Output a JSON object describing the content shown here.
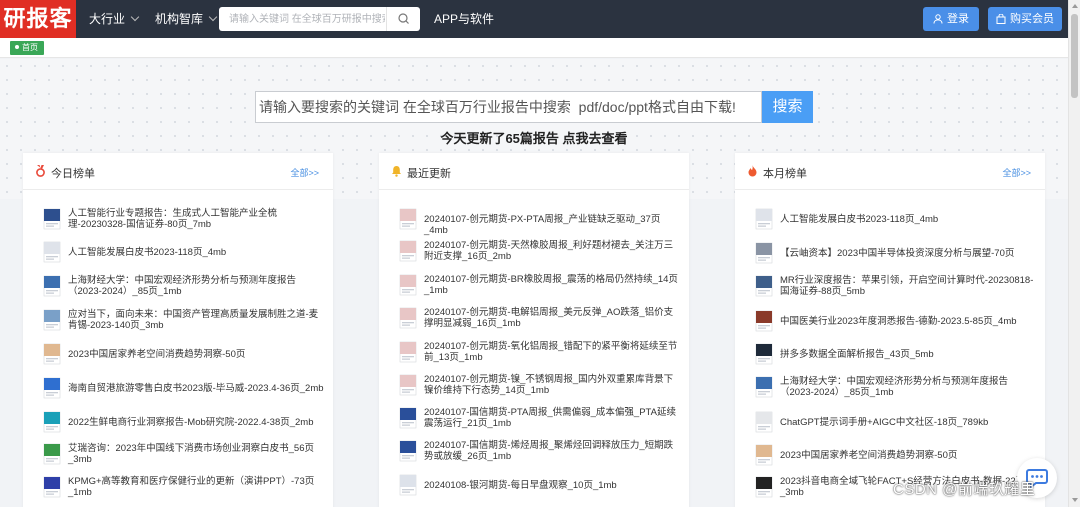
{
  "nav": {
    "logo": "研报客",
    "industry": "大行业",
    "institutions": "机构智库",
    "search_placeholder": "请输入关键词 在全球百万研报中搜索",
    "app": "APP与软件",
    "login": "登录",
    "buy_member": "购买会员"
  },
  "breadcrumb": {
    "home": "首页"
  },
  "hero": {
    "search_placeholder": "请输入要搜索的关键词 在全球百万行业报告中搜索  pdf/doc/ppt格式自由下载!",
    "search_button": "搜索",
    "update_text": "今天更新了65篇报告 点我去查看"
  },
  "colors": {
    "nav_bg": "#2b3340",
    "logo_bg": "#e02e24",
    "accent": "#4a8fe8",
    "home_badge": "#3aa757"
  },
  "cards": [
    {
      "title": "今日榜单",
      "icon": "medal-icon",
      "more": "全部>>",
      "items": [
        {
          "text": "人工智能行业专题报告：生成式人工智能产业全梳理-20230328-国信证券-80页_7mb",
          "thumb": "report-cover-icon",
          "color": "#2d4f8e"
        },
        {
          "text": "人工智能发展白皮书2023-118页_4mb",
          "thumb": "report-cover-icon",
          "color": "#dfe3ea"
        },
        {
          "text": "上海财经大学：中国宏观经济形势分析与预测年度报告（2023-2024）_85页_1mb",
          "thumb": "report-cover-icon",
          "color": "#3c6fb0"
        },
        {
          "text": "应对当下，面向未来：中国资产管理高质量发展制胜之道-麦肯锡-2023-140页_3mb",
          "thumb": "report-cover-icon",
          "color": "#7aa0c8"
        },
        {
          "text": "2023中国居家养老空间消费趋势洞察-50页",
          "thumb": "report-cover-icon",
          "color": "#e0b890"
        },
        {
          "text": "海南自贸港旅游零售白皮书2023版-毕马威-2023.4-36页_2mb",
          "thumb": "report-cover-icon",
          "color": "#2f6fd0"
        },
        {
          "text": "2022生鲜电商行业洞察报告-Mob研究院-2022.4-38页_2mb",
          "thumb": "report-cover-icon",
          "color": "#1aa0b8"
        },
        {
          "text": "艾瑞咨询：2023年中国线下消费市场创业洞察白皮书_56页_3mb",
          "thumb": "report-cover-icon",
          "color": "#3a9a4a"
        },
        {
          "text": "KPMG+高等教育和医疗保健行业的更新（演讲PPT）-73页_1mb",
          "thumb": "report-cover-icon",
          "color": "#2e3fa8"
        }
      ]
    },
    {
      "title": "最近更新",
      "icon": "bell-icon",
      "more": "",
      "items": [
        {
          "text": "20240107-创元期货-PX-PTA周报_产业链缺乏驱动_37页_4mb",
          "thumb": "report-cover-icon",
          "color": "#e8c6c6"
        },
        {
          "text": "20240107-创元期货-天然橡胶周报_利好题材褪去_关注万三附近支撑_16页_2mb",
          "thumb": "report-cover-icon",
          "color": "#e8c6c6"
        },
        {
          "text": "20240107-创元期货-BR橡胶周报_震荡的格局仍然持续_14页_1mb",
          "thumb": "report-cover-icon",
          "color": "#e8c6c6"
        },
        {
          "text": "20240107-创元期货-电解铝周报_美元反弹_AO跌落_铝价支撑明显减弱_16页_1mb",
          "thumb": "report-cover-icon",
          "color": "#e8c6c6"
        },
        {
          "text": "20240107-创元期货-氧化铝周报_错配下的紧平衡将延续至节前_13页_1mb",
          "thumb": "report-cover-icon",
          "color": "#e8c6c6"
        },
        {
          "text": "20240107-创元期货-镍_不锈钢周报_国内外双重累库背景下镍价维持下行态势_14页_1mb",
          "thumb": "report-cover-icon",
          "color": "#e8c6c6"
        },
        {
          "text": "20240107-国信期货-PTA周报_供需偏弱_成本偏强_PTA延续震荡运行_21页_1mb",
          "thumb": "report-cover-icon",
          "color": "#2a4f9a"
        },
        {
          "text": "20240107-国信期货-烯烃周报_聚烯烃回调释放压力_短期跌势或放缓_26页_1mb",
          "thumb": "report-cover-icon",
          "color": "#2a4f9a"
        },
        {
          "text": "20240108-银河期货-每日早盘观察_10页_1mb",
          "thumb": "report-cover-icon",
          "color": "#dde2ea"
        }
      ]
    },
    {
      "title": "本月榜单",
      "icon": "fire-icon",
      "more": "全部>>",
      "items": [
        {
          "text": "人工智能发展白皮书2023-118页_4mb",
          "thumb": "report-cover-icon",
          "color": "#dfe3ea"
        },
        {
          "text": "【云岫资本】2023中国半导体投资深度分析与展望-70页",
          "thumb": "report-cover-icon",
          "color": "#8a94a4"
        },
        {
          "text": "MR行业深度报告：苹果引领，开启空间计算时代-20230818-国海证券-88页_5mb",
          "thumb": "report-cover-icon",
          "color": "#3f5f8a"
        },
        {
          "text": "中国医美行业2023年度洞悉报告-德勤-2023.5-85页_4mb",
          "thumb": "report-cover-icon",
          "color": "#8a3a2a"
        },
        {
          "text": "拼多多数据全面解析报告_43页_5mb",
          "thumb": "report-cover-icon",
          "color": "#1e2a3a"
        },
        {
          "text": "上海财经大学：中国宏观经济形势分析与预测年度报告（2023-2024）_85页_1mb",
          "thumb": "report-cover-icon",
          "color": "#3c6fb0"
        },
        {
          "text": "ChatGPT提示词手册+AIGC中文社区-18页_789kb",
          "thumb": "report-cover-icon",
          "color": "#e5e7ea"
        },
        {
          "text": "2023中国居家养老空间消费趋势洞察-50页",
          "thumb": "report-cover-icon",
          "color": "#e0b890"
        },
        {
          "text": "2023抖音电商全域飞轮FACT+S经营方法白皮书-数据-22页_3mb",
          "thumb": "report-cover-icon",
          "color": "#222"
        }
      ]
    }
  ],
  "watermark": "CSDN @前端玖耀里"
}
